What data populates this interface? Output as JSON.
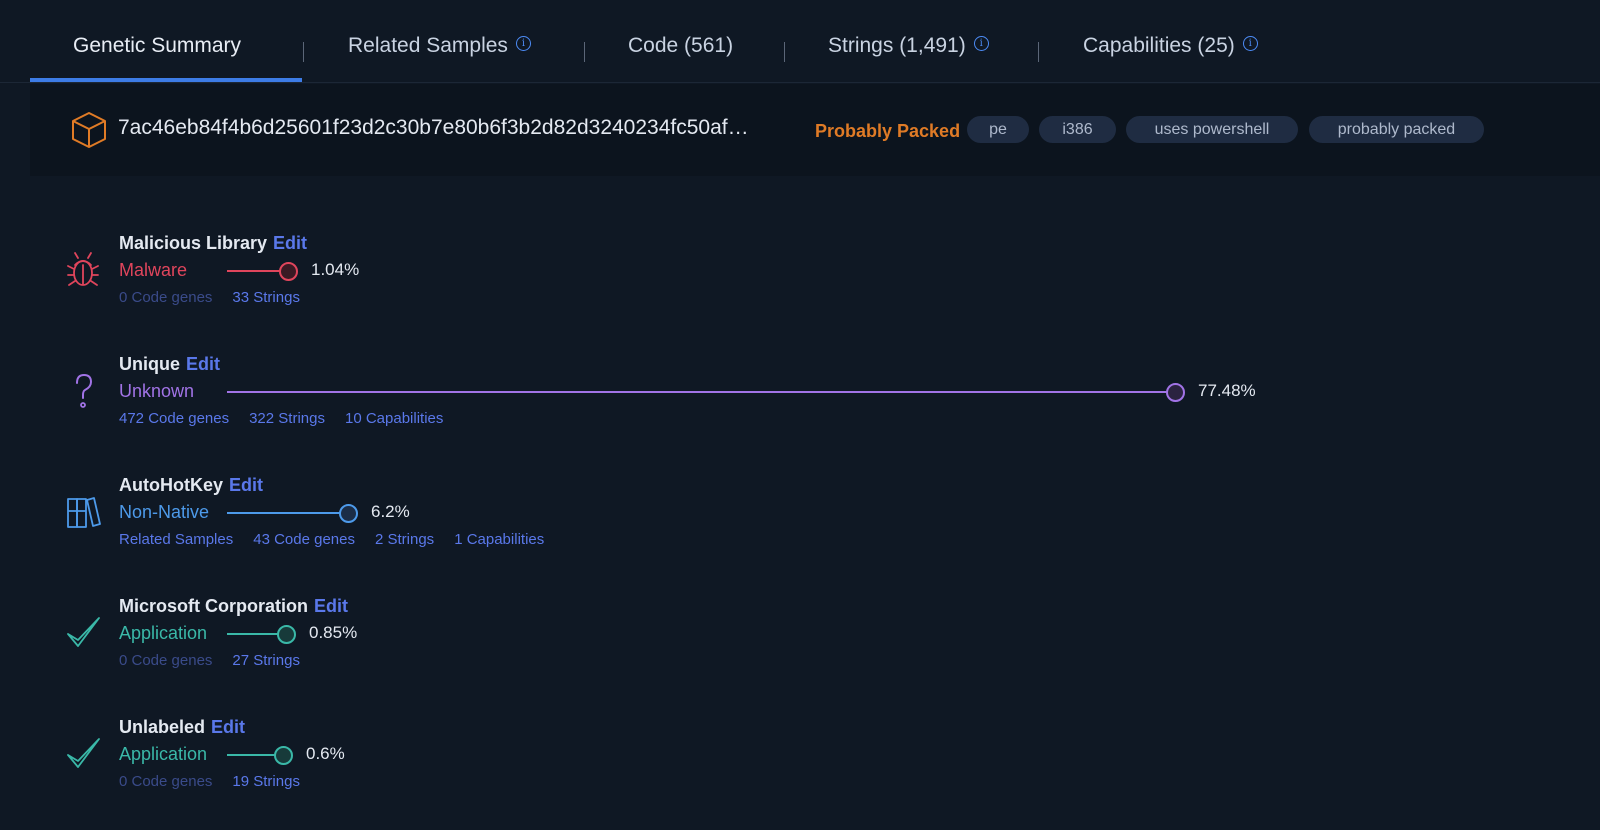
{
  "tabs": [
    {
      "label": "Genetic Summary",
      "info": false,
      "active": true
    },
    {
      "label": "Related Samples",
      "info": true
    },
    {
      "label": "Code (561)",
      "info": false
    },
    {
      "label": "Strings (1,491)",
      "info": true
    },
    {
      "label": "Capabilities (25)",
      "info": true
    }
  ],
  "header": {
    "hash": "7ac46eb84f4b6d25601f23d2c30b7e80b6f3b2d82d3240234fc50af…",
    "status": "Probably Packed",
    "status_color": "#e07b26",
    "tags": [
      "pe",
      "i386",
      "uses powershell",
      "probably packed"
    ]
  },
  "families": [
    {
      "title": "Malicious Library",
      "edit": "Edit",
      "classification": "Malware",
      "color": "#e0455c",
      "percent_label": "1.04%",
      "percent": 1.04,
      "icon": "bug-icon",
      "links": [
        {
          "text": "0 Code genes",
          "dim": true
        },
        {
          "text": "33 Strings",
          "dim": false
        }
      ]
    },
    {
      "title": "Unique",
      "edit": "Edit",
      "classification": "Unknown",
      "color": "#a173e6",
      "percent_label": "77.48%",
      "percent": 77.48,
      "icon": "question-icon",
      "links": [
        {
          "text": "472 Code genes",
          "dim": false
        },
        {
          "text": "322 Strings",
          "dim": false
        },
        {
          "text": "10 Capabilities",
          "dim": false
        }
      ]
    },
    {
      "title": "AutoHotKey",
      "edit": "Edit",
      "classification": "Non-Native",
      "color": "#4d9aea",
      "percent_label": "6.2%",
      "percent": 6.2,
      "icon": "library-icon",
      "links": [
        {
          "text": "Related Samples",
          "dim": false
        },
        {
          "text": "43 Code genes",
          "dim": false
        },
        {
          "text": "2 Strings",
          "dim": false
        },
        {
          "text": "1 Capabilities",
          "dim": false
        }
      ]
    },
    {
      "title": "Microsoft Corporation",
      "edit": "Edit",
      "classification": "Application",
      "color": "#3ab8a8",
      "percent_label": "0.85%",
      "percent": 0.85,
      "icon": "checkmark-icon",
      "links": [
        {
          "text": "0 Code genes",
          "dim": true
        },
        {
          "text": "27 Strings",
          "dim": false
        }
      ]
    },
    {
      "title": "Unlabeled",
      "edit": "Edit",
      "classification": "Application",
      "color": "#3ab8a8",
      "percent_label": "0.6%",
      "percent": 0.6,
      "icon": "checkmark-icon",
      "links": [
        {
          "text": "0 Code genes",
          "dim": true
        },
        {
          "text": "19 Strings",
          "dim": false
        }
      ]
    }
  ]
}
